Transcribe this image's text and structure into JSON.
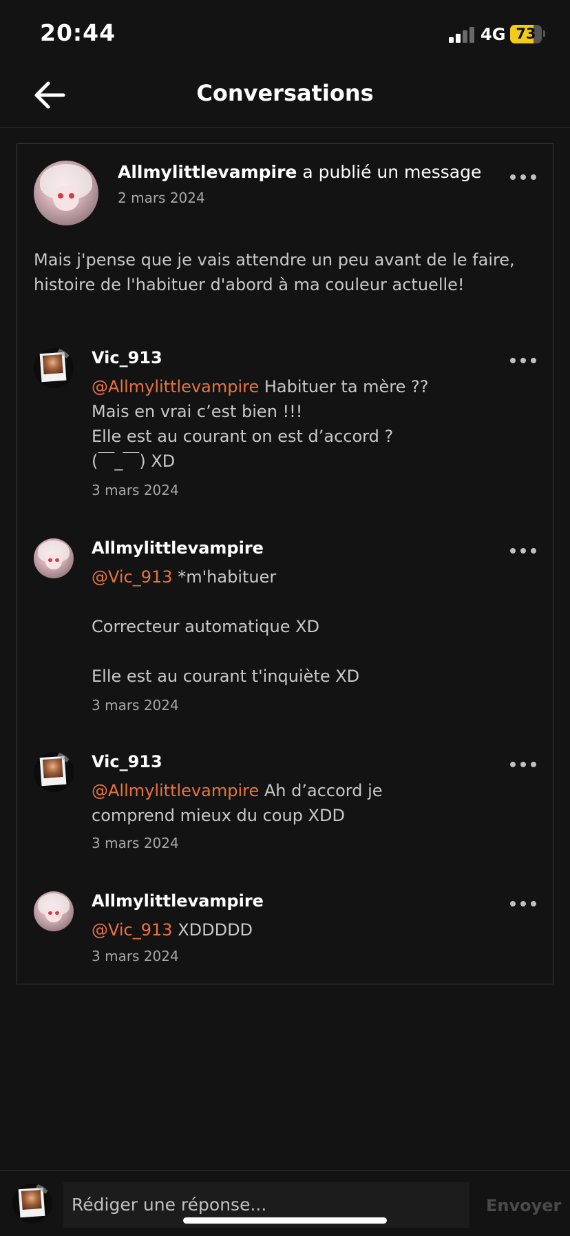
{
  "status_bar": {
    "time": "20:44",
    "network": "4G",
    "battery": "73",
    "battery_level": 0.73
  },
  "header": {
    "title": "Conversations",
    "back_icon": "arrow-left-icon"
  },
  "original_post": {
    "author": "Allmylittlevampire",
    "action": " a publié un message",
    "date": "2 mars 2024",
    "body": "Mais j'pense que je vais attendre un peu avant de le faire, histoire de l'habituer d'abord à ma couleur actuelle!"
  },
  "comments": [
    {
      "author": "Vic_913",
      "mention": "@Allmylittlevampire",
      "first_line": " Habituer ta mère ??",
      "lines": [
        "Mais en vrai c’est bien !!!",
        "Elle est au courant on est d’accord ?",
        "(￣_￣)   XD"
      ],
      "date": "3 mars 2024"
    },
    {
      "author": "Allmylittlevampire",
      "mention": "@Vic_913",
      "first_line": "  *m'habituer",
      "lines": [
        "",
        "Correcteur automatique XD",
        "",
        "Elle est au courant t'inquiète XD"
      ],
      "date": "3 mars 2024"
    },
    {
      "author": "Vic_913",
      "mention": "@Allmylittlevampire",
      "first_line": " Ah d’accord je comprend mieux du coup XDD",
      "lines": [],
      "date": "3 mars 2024"
    },
    {
      "author": "Allmylittlevampire",
      "mention": "@Vic_913",
      "first_line": "  XDDDDD",
      "lines": [],
      "date": "3 mars 2024"
    }
  ],
  "reply_bar": {
    "placeholder": "Rédiger une réponse...",
    "send_label": "Envoyer"
  }
}
